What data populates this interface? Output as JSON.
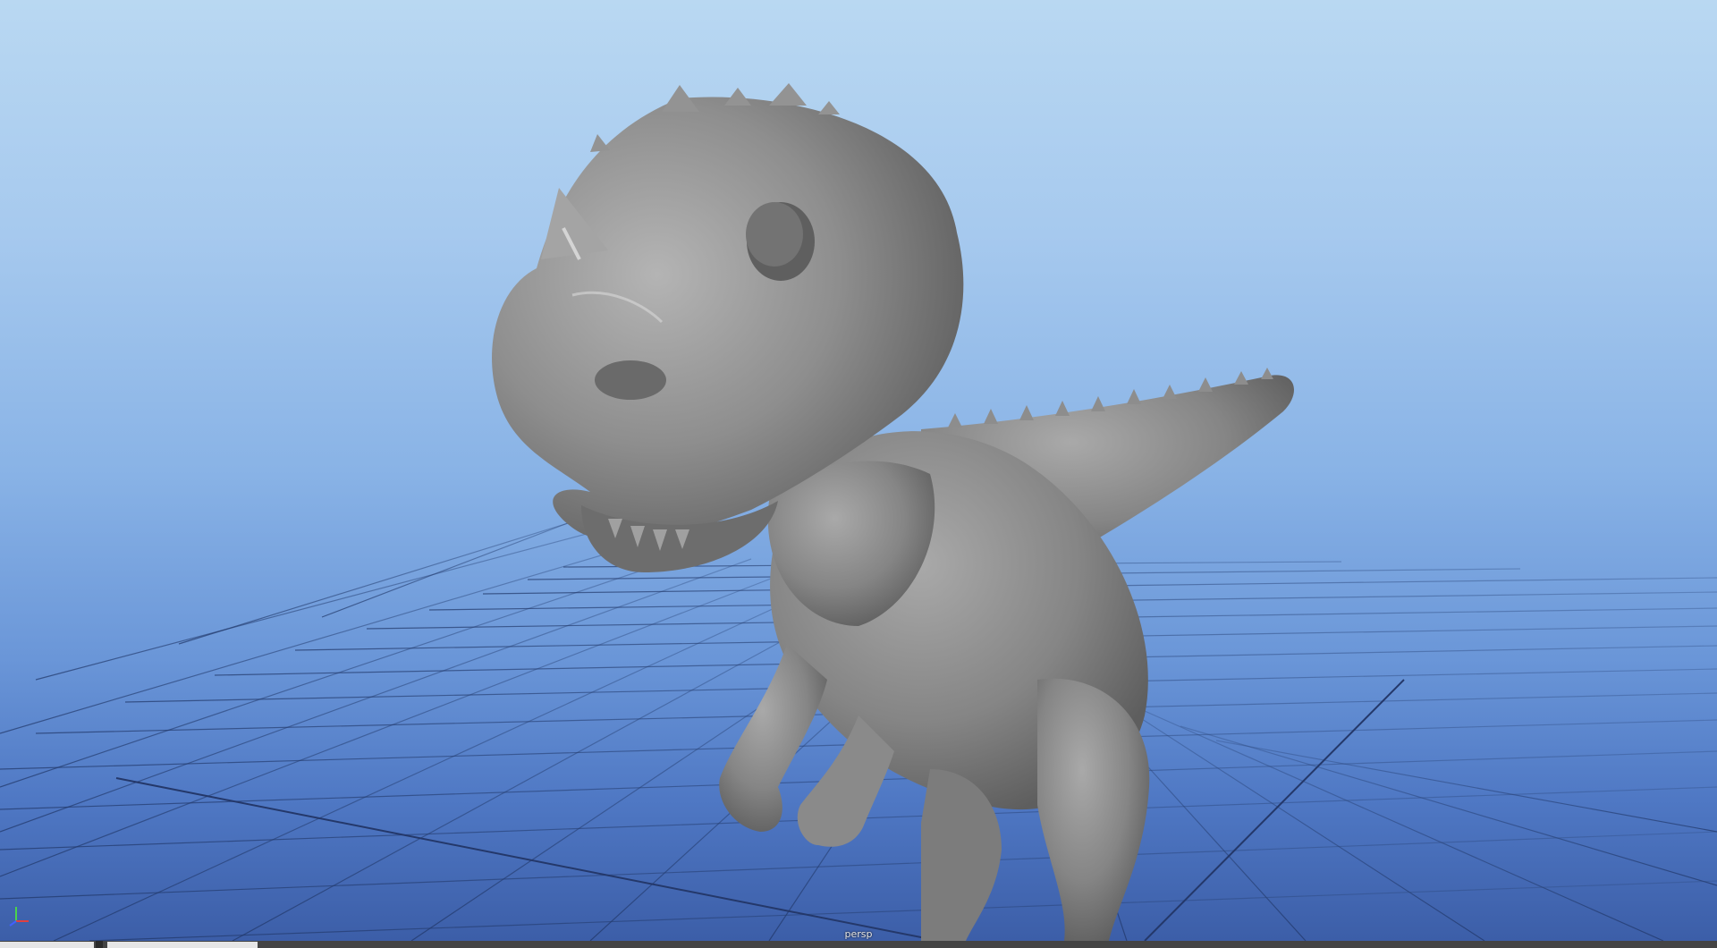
{
  "viewport": {
    "camera_label": "persp",
    "background_top": "#b9d8f2",
    "background_bottom": "#3c5ea8",
    "grid_color": "#2d4a80",
    "model_color": "#8a8a8a"
  },
  "icons": {
    "axis_gizmo": "xyz-axis-icon"
  }
}
